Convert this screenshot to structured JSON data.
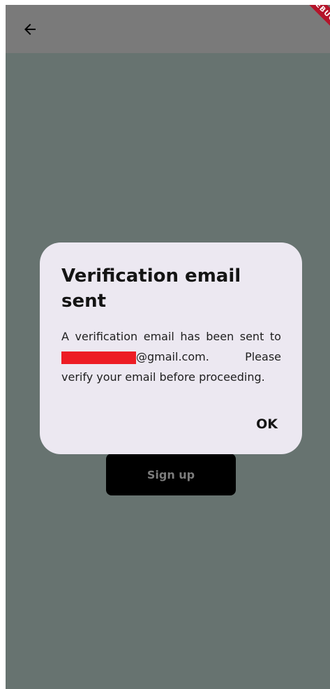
{
  "appbar": {
    "back_icon": "arrow-left-icon"
  },
  "debug_banner": {
    "label": "DEBUG"
  },
  "signup": {
    "label": "Sign up"
  },
  "dialog": {
    "title": "Verification email sent",
    "body_part1_word1": "A",
    "body_part1_word2": "verification",
    "body_part1_word3": "email",
    "body_part1_word4": "has",
    "body_part1_word5": "been",
    "body_part1_word6": "sent",
    "body_part1_word7": "to",
    "email_domain": "@gmail.com.",
    "please": "Please",
    "body_line3": "verify your email before proceeding.",
    "ok_label": "OK"
  },
  "colors": {
    "scrim": "#677370",
    "appbar": "#7a7a7a",
    "dialog_bg": "#ece8f1",
    "redaction": "#ed1c24",
    "button_bg": "#000000"
  }
}
